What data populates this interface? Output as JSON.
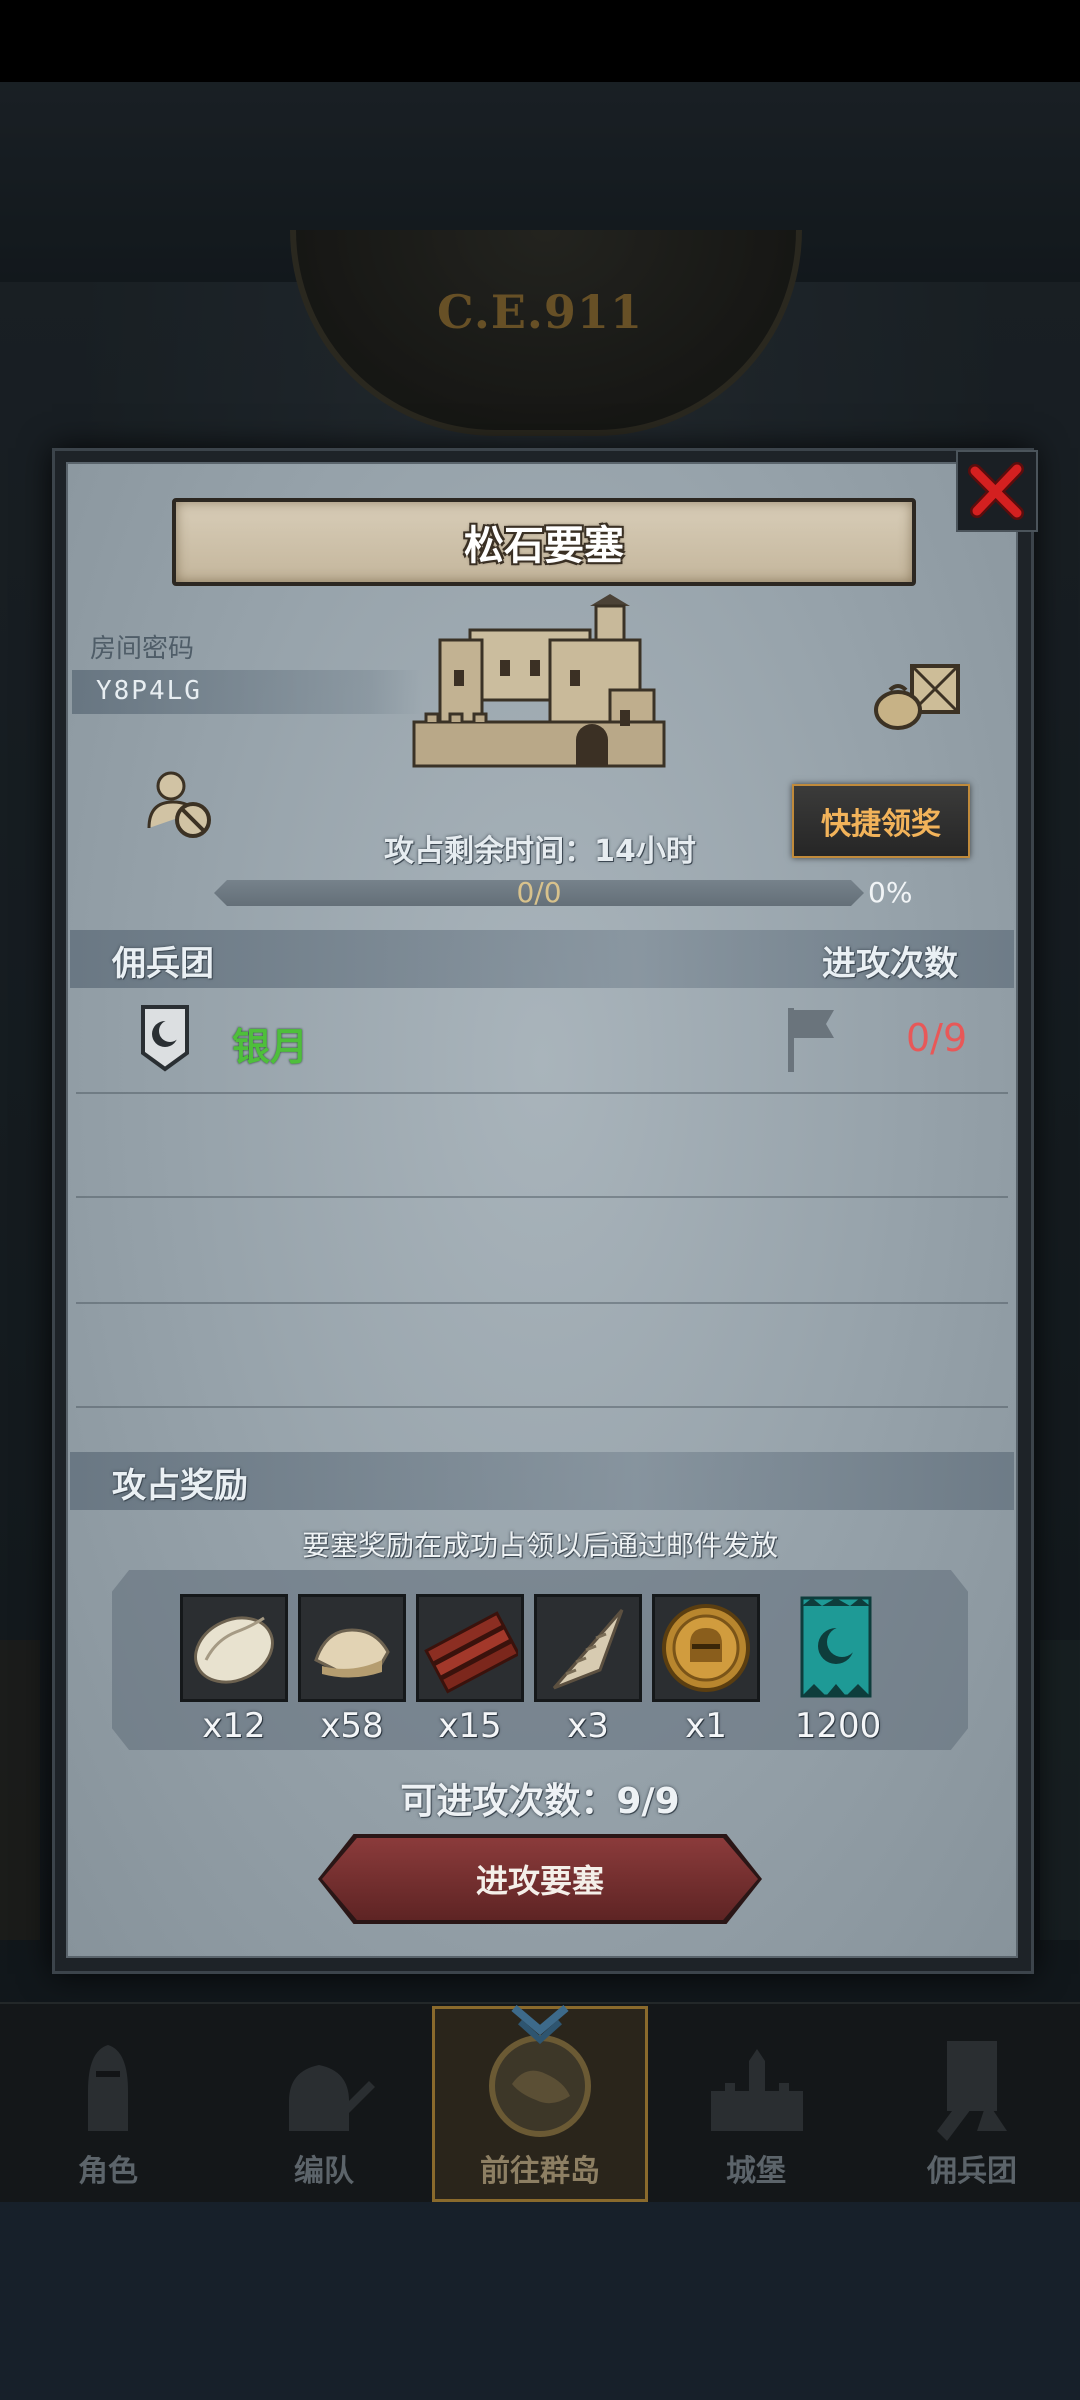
{
  "header": {
    "era": "C.E.911"
  },
  "modal": {
    "title": "松石要塞",
    "room_code_label": "房间密码",
    "room_code": "Y8P4LG",
    "quick_claim": "快捷领奖",
    "time_label": "攻占剩余时间：14小时",
    "progress_text": "0/0",
    "progress_percent": "0%",
    "progress_fraction": 0,
    "mercenary_header": "佣兵团",
    "attack_count_header": "进攻次数",
    "guild": {
      "name": "银月",
      "attacks": "0/9"
    },
    "reward_header": "攻占奖励",
    "reward_note": "要塞奖励在成功占领以后通过邮件发放",
    "rewards": [
      {
        "icon": "fur-icon",
        "qty": "x12"
      },
      {
        "icon": "pelt-icon",
        "qty": "x58"
      },
      {
        "icon": "timber-icon",
        "qty": "x15"
      },
      {
        "icon": "horn-icon",
        "qty": "x3"
      },
      {
        "icon": "knight-coin-icon",
        "qty": "x1"
      },
      {
        "icon": "guild-banner-icon",
        "qty": "1200"
      }
    ],
    "attacks_available": "可进攻次数：9/9",
    "attack_button": "进攻要塞"
  },
  "nav": {
    "tabs": [
      {
        "label": "角色",
        "icon": "knight-icon"
      },
      {
        "label": "编队",
        "icon": "squad-icon"
      },
      {
        "label": "前往群岛",
        "icon": "globe-icon",
        "active": true
      },
      {
        "label": "城堡",
        "icon": "castle-icon"
      },
      {
        "label": "佣兵团",
        "icon": "mercenary-icon"
      }
    ]
  },
  "colors": {
    "accent_gold": "#f2b35a",
    "guild_green": "#4ebf3b",
    "count_red": "#e85858",
    "attack_button": "#8b3b3b"
  }
}
